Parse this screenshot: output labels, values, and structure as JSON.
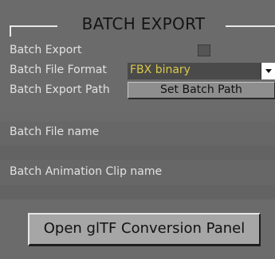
{
  "group": {
    "title": "BATCH EXPORT"
  },
  "rows": {
    "batch_export_label": "Batch Export",
    "batch_export_checked": false,
    "batch_file_format_label": "Batch File Format",
    "batch_file_format_value": "FBX binary",
    "batch_export_path_label": "Batch Export Path",
    "set_batch_path_button": "Set Batch Path",
    "batch_file_name_label": "Batch File name",
    "batch_animation_clip_label": "Batch Animation Clip name"
  },
  "actions": {
    "open_gltf_button": "Open glTF Conversion Panel"
  },
  "colors": {
    "panel_bg": "#6b6b6b",
    "dropdown_text": "#d9c84a",
    "label_text": "#e2e2e2"
  }
}
